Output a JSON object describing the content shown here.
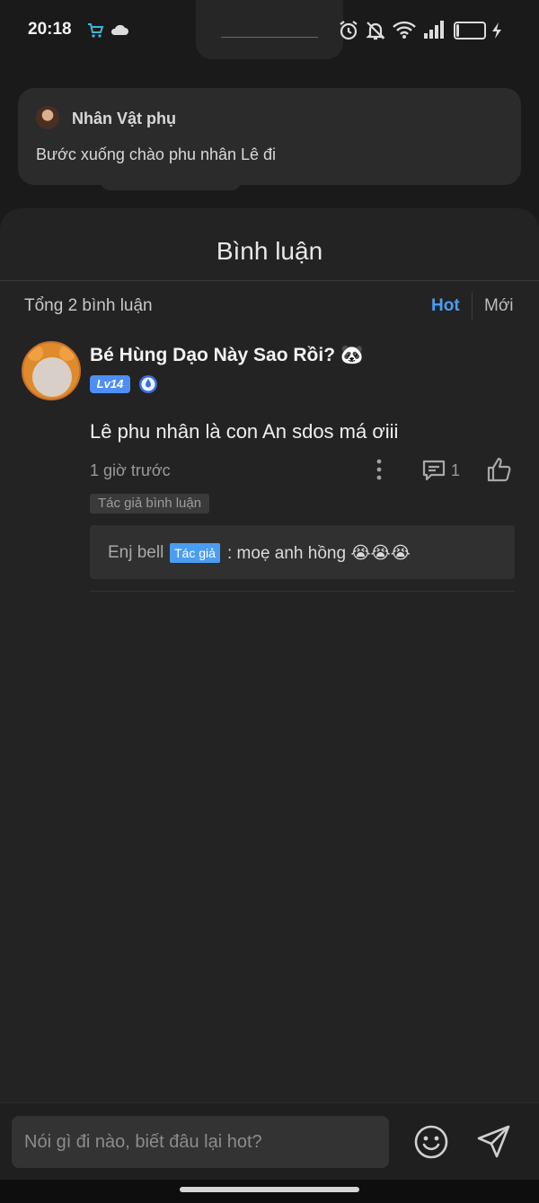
{
  "status_bar": {
    "time": "20:18",
    "battery_level": "10",
    "battery_fraction": 0.1,
    "icons": [
      "shopping-cart-icon",
      "cloud-icon",
      "alarm-icon",
      "bell-muted-icon",
      "wifi-icon",
      "signal-icon",
      "battery-icon",
      "charging-icon"
    ]
  },
  "story": {
    "character_name": "Nhân Vật phụ",
    "line": "Bước xuống chào phu nhân Lê đi"
  },
  "comments_panel": {
    "title": "Bình luận",
    "total_label": "Tổng 2 bình luận",
    "sort_hot": "Hot",
    "sort_new": "Mới",
    "active_sort": "Hot",
    "comments": [
      {
        "username": "Bé Hùng Dạo Này Sao Rồi? 🐼",
        "level": "Lv14",
        "text": "Lê phu nhân là con An sdos má ơiii",
        "time": "1 giờ trước",
        "reply_count": "1",
        "author_tag": "Tác giả bình luận",
        "reply": {
          "username": "Enj bell",
          "badge": "Tác giả",
          "text": ": moẹ  anh hồng 😭😭😭"
        }
      }
    ]
  },
  "composer": {
    "placeholder": "Nói gì đi nào, biết đâu lại hot?"
  },
  "colors": {
    "accent": "#4a9df0",
    "level_badge": "#4e8ef5",
    "background": "#232323"
  }
}
